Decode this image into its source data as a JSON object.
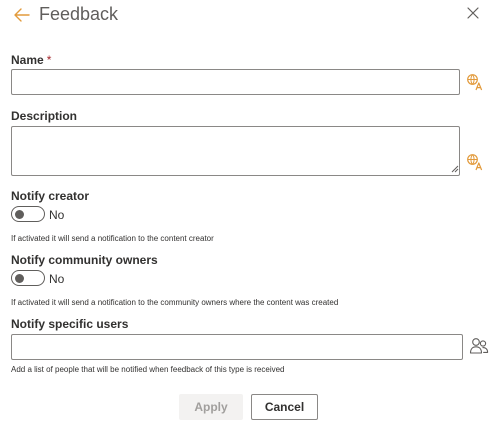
{
  "panel": {
    "title": "Feedback",
    "back_icon": "arrow-left-icon",
    "close_icon": "close-icon"
  },
  "fields": {
    "name": {
      "label": "Name",
      "required_mark": "*",
      "value": ""
    },
    "description": {
      "label": "Description",
      "value": ""
    },
    "translate_icon": "translate-icon"
  },
  "notify_creator": {
    "label": "Notify creator",
    "state": "No",
    "hint": "If activated it will send a notification to the content creator"
  },
  "notify_owners": {
    "label": "Notify community owners",
    "state": "No",
    "hint": "If activated it will send a notification to the community owners where the content was created"
  },
  "notify_users": {
    "label": "Notify specific users",
    "value": "",
    "hint": "Add a list of people that will be notified when feedback of this type is received",
    "people_icon": "people-picker-icon"
  },
  "buttons": {
    "apply": "Apply",
    "cancel": "Cancel"
  },
  "colors": {
    "accent": "#e29a3b",
    "border": "#8a8886",
    "disabled_bg": "#f3f2f1",
    "required": "#a4262c"
  }
}
